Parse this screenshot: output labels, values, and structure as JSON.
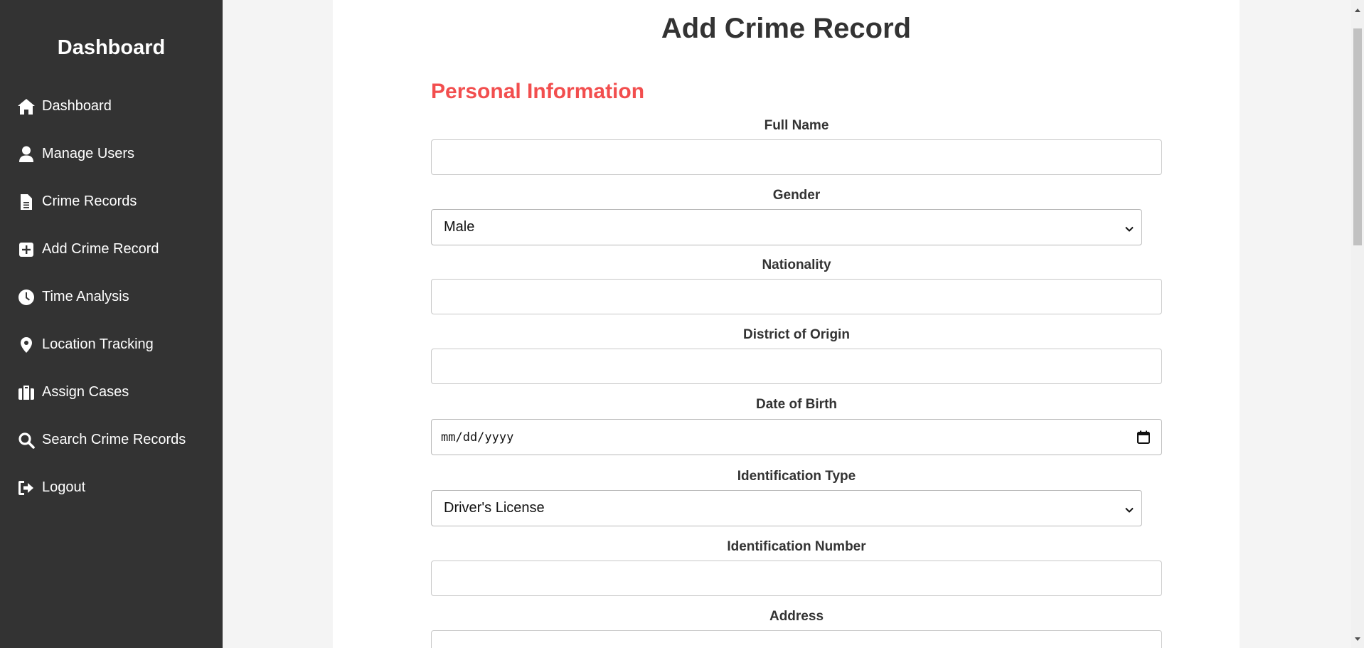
{
  "sidebar": {
    "title": "Dashboard",
    "items": [
      {
        "label": "Dashboard",
        "icon": "home-icon"
      },
      {
        "label": "Manage Users",
        "icon": "user-icon"
      },
      {
        "label": "Crime Records",
        "icon": "file-icon"
      },
      {
        "label": "Add Crime Record",
        "icon": "plus-square-icon"
      },
      {
        "label": "Time Analysis",
        "icon": "clock-icon"
      },
      {
        "label": "Location Tracking",
        "icon": "map-pin-icon"
      },
      {
        "label": "Assign Cases",
        "icon": "briefcase-icon"
      },
      {
        "label": "Search Crime Records",
        "icon": "search-icon"
      },
      {
        "label": "Logout",
        "icon": "logout-icon"
      }
    ]
  },
  "main": {
    "title": "Add Crime Record",
    "section_title": "Personal Information",
    "fields": {
      "full_name": {
        "label": "Full Name",
        "value": ""
      },
      "gender": {
        "label": "Gender",
        "value": "Male"
      },
      "nationality": {
        "label": "Nationality",
        "value": ""
      },
      "district": {
        "label": "District of Origin",
        "value": ""
      },
      "dob": {
        "label": "Date of Birth",
        "placeholder": "mm/dd/yyyy"
      },
      "id_type": {
        "label": "Identification Type",
        "value": "Driver's License"
      },
      "id_number": {
        "label": "Identification Number",
        "value": ""
      },
      "address": {
        "label": "Address",
        "value": ""
      }
    }
  },
  "colors": {
    "sidebar_bg": "#333333",
    "section_accent": "#f24e4e",
    "page_bg": "#f4f4f4"
  }
}
